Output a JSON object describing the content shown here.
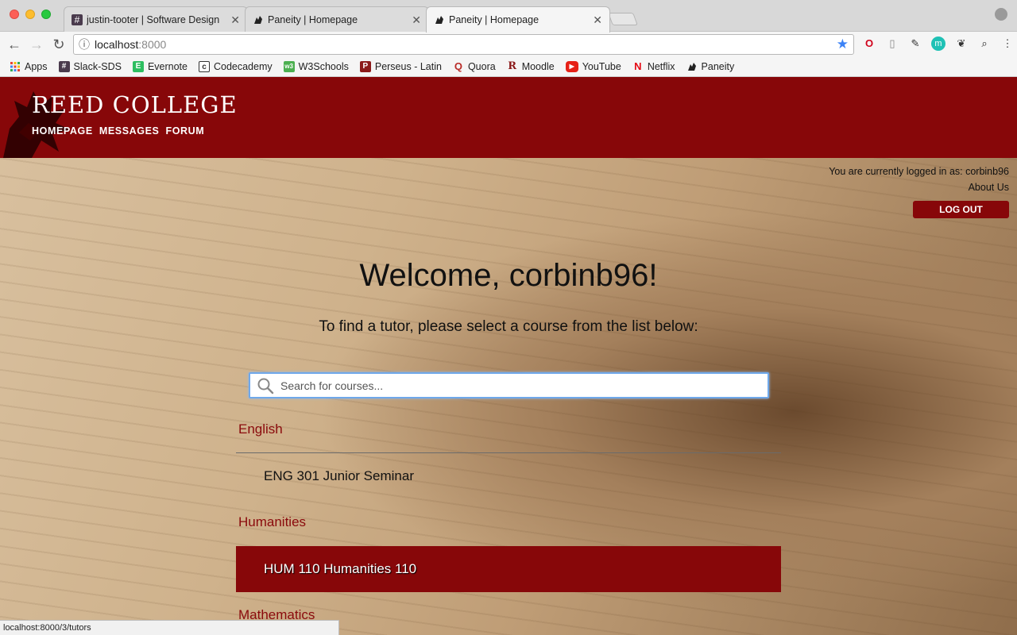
{
  "browser": {
    "tabs": [
      {
        "title": "justin-tooter | Software Design",
        "favicon": "#",
        "active": false
      },
      {
        "title": "Paneity | Homepage",
        "favicon": "griffin-icon",
        "active": false
      },
      {
        "title": "Paneity | Homepage",
        "favicon": "griffin-icon",
        "active": true
      }
    ],
    "address": {
      "host": "localhost",
      "port": ":8000"
    },
    "bookmarks": [
      {
        "label": "Apps",
        "icon": "apps-grid-icon",
        "color": "#e0e0e0"
      },
      {
        "label": "Slack-SDS",
        "icon": "#",
        "color": "#4a3b4d"
      },
      {
        "label": "Evernote",
        "icon": "E",
        "color": "#2dbe60"
      },
      {
        "label": "Codecademy",
        "icon": "C",
        "color": "#333333"
      },
      {
        "label": "W3Schools",
        "icon": "w3",
        "color": "#4caf50"
      },
      {
        "label": "Perseus - Latin",
        "icon": "P",
        "color": "#8b1a1a"
      },
      {
        "label": "Quora",
        "icon": "Q",
        "color": "#b92b27"
      },
      {
        "label": "Moodle",
        "icon": "R",
        "color": "#8b1a1a"
      },
      {
        "label": "YouTube",
        "icon": "▶",
        "color": "#e62117"
      },
      {
        "label": "Netflix",
        "icon": "N",
        "color": "#e50914"
      },
      {
        "label": "Paneity",
        "icon": "griffin-icon",
        "color": "#333333"
      }
    ],
    "status_url": "localhost:8000/3/tutors"
  },
  "header": {
    "brand": "REED COLLEGE",
    "nav": [
      "HOMEPAGE",
      "MESSAGES",
      "FORUM"
    ],
    "color": "#870709"
  },
  "account": {
    "logged_in_text": "You are currently logged in as: corbinb96",
    "about": "About Us",
    "logout": "LOG OUT"
  },
  "main": {
    "welcome": "Welcome, corbinb96!",
    "instructions": "To find a tutor, please select a course from the list below:",
    "search_placeholder": "Search for courses...",
    "departments": [
      {
        "name": "English",
        "courses": [
          "ENG 301 Junior Seminar"
        ]
      },
      {
        "name": "Humanities",
        "courses": [
          "HUM 110 Humanities 110"
        ]
      },
      {
        "name": "Mathematics",
        "courses": []
      }
    ]
  }
}
